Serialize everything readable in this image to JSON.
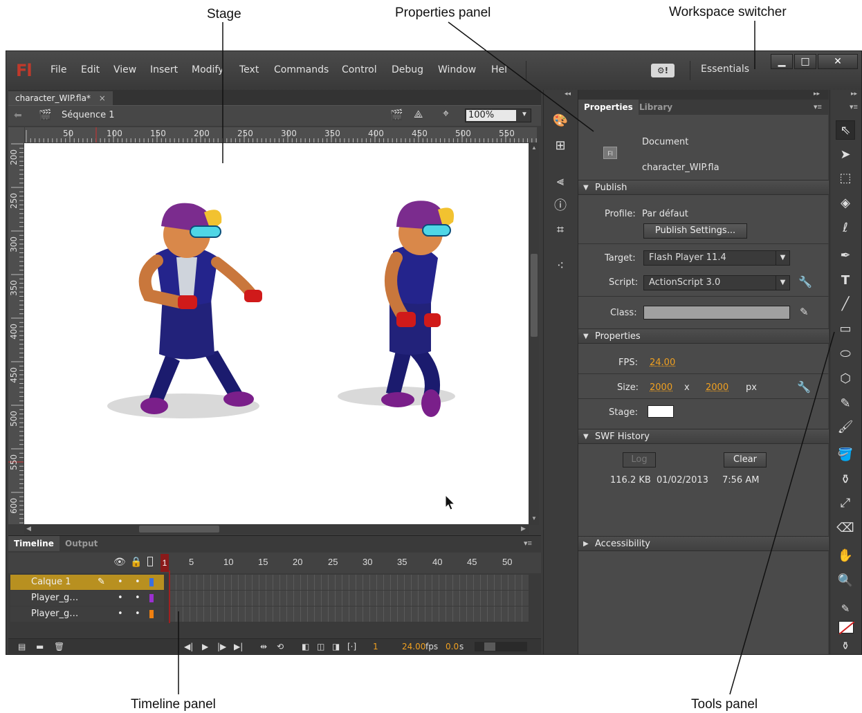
{
  "callouts": {
    "stage": "Stage",
    "properties_panel": "Properties panel",
    "workspace_switcher": "Workspace switcher",
    "timeline_panel": "Timeline panel",
    "tools_panel": "Tools panel"
  },
  "app": {
    "logo": "Fl",
    "menu": [
      "File",
      "Edit",
      "View",
      "Insert",
      "Modify",
      "Text",
      "Commands",
      "Control",
      "Debug",
      "Window",
      "Help"
    ],
    "workspace": "Essentials",
    "badge": "⚙!"
  },
  "document": {
    "tab_label": "character_WIP.fla*",
    "tab_close": "×",
    "scene": "Séquence 1",
    "zoom": "100%"
  },
  "rulers": {
    "h_ticks": [
      "50",
      "100",
      "150",
      "200",
      "250",
      "300",
      "350",
      "400",
      "450",
      "500",
      "550"
    ],
    "v_ticks": [
      "200",
      "250",
      "300",
      "350",
      "400",
      "450",
      "500",
      "550",
      "600"
    ]
  },
  "timeline": {
    "tabs": [
      "Timeline",
      "Output"
    ],
    "frame_numbers": [
      "1",
      "5",
      "10",
      "15",
      "20",
      "25",
      "30",
      "35",
      "40",
      "45",
      "50"
    ],
    "layers": [
      "Calque 1",
      "Player_g…",
      "Player_g…"
    ],
    "layer_colors": [
      "#3a6fe0",
      "#9b30d0",
      "#f08010"
    ],
    "current_frame": "1",
    "fps": "24.00",
    "fps_unit": "fps",
    "time": "0.0",
    "time_unit": "s"
  },
  "properties": {
    "tabs": [
      "Properties",
      "Library"
    ],
    "doc_type": "Document",
    "doc_icon": "Fl",
    "file_name": "character_WIP.fla",
    "publish_header": "Publish",
    "profile_label": "Profile:",
    "profile_value": "Par défaut",
    "publish_settings": "Publish Settings...",
    "target_label": "Target:",
    "target_value": "Flash Player 11.4",
    "script_label": "Script:",
    "script_value": "ActionScript 3.0",
    "class_label": "Class:",
    "properties_header": "Properties",
    "fps_label": "FPS:",
    "fps_value": "24.00",
    "size_label": "Size:",
    "width": "2000",
    "size_x": "x",
    "height": "2000",
    "size_unit": "px",
    "stage_label": "Stage:",
    "stage_color": "#ffffff",
    "swf_header": "SWF History",
    "log_button": "Log",
    "clear_button": "Clear",
    "history_size": "116.2 KB",
    "history_date": "01/02/2013",
    "history_time": "7:56 AM",
    "accessibility_header": "Accessibility"
  }
}
